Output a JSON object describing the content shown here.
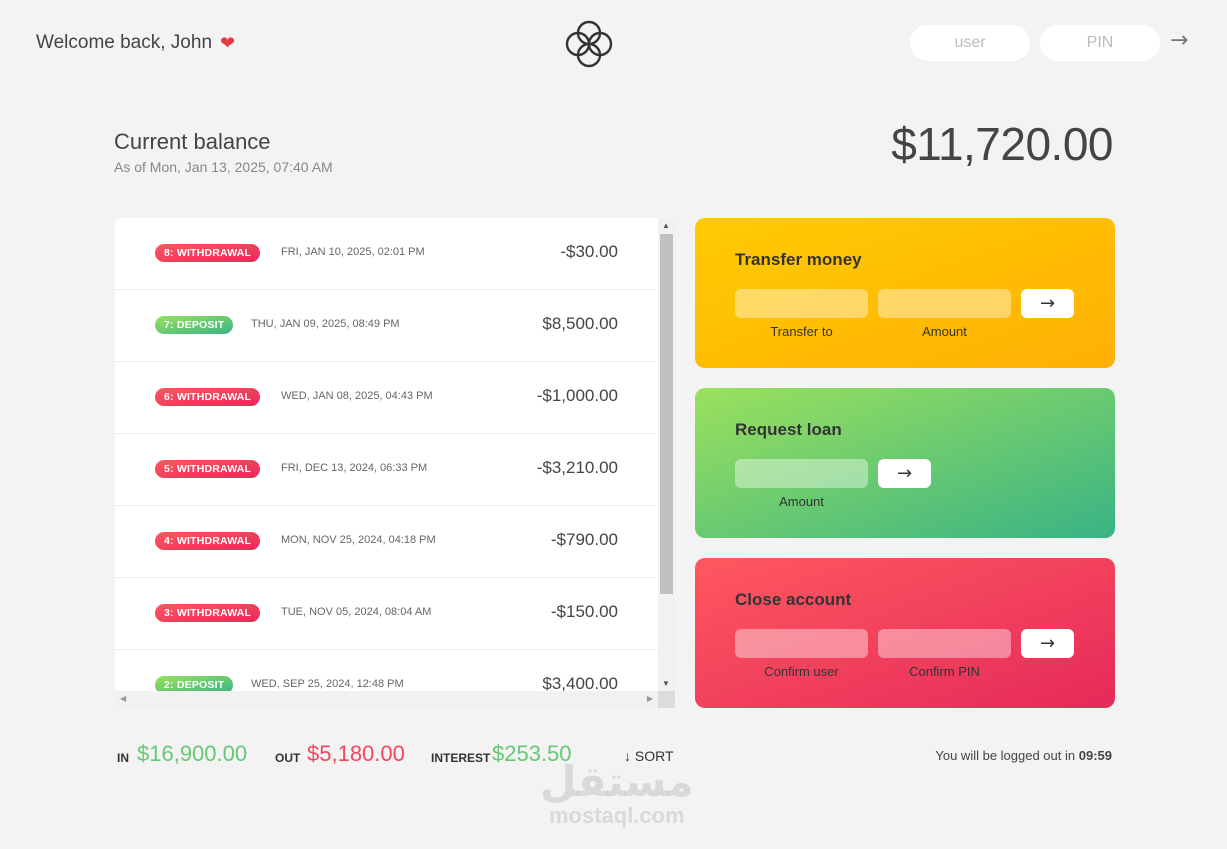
{
  "nav": {
    "welcome": "Welcome back, John",
    "heart": "❤",
    "user_placeholder": "user",
    "pin_placeholder": "PIN",
    "login_arrow": "→"
  },
  "balance": {
    "label": "Current balance",
    "date": "As of Mon, Jan 13, 2025, 07:40 AM",
    "value": "$11,720.00"
  },
  "movements": [
    {
      "type": "8: WITHDRAWAL",
      "kind": "withdrawal",
      "date": "FRI, JAN 10, 2025, 02:01 PM",
      "value": "-$30.00"
    },
    {
      "type": "7: DEPOSIT",
      "kind": "deposit",
      "date": "THU, JAN 09, 2025, 08:49 PM",
      "value": "$8,500.00"
    },
    {
      "type": "6: WITHDRAWAL",
      "kind": "withdrawal",
      "date": "WED, JAN 08, 2025, 04:43 PM",
      "value": "-$1,000.00"
    },
    {
      "type": "5: WITHDRAWAL",
      "kind": "withdrawal",
      "date": "FRI, DEC 13, 2024, 06:33 PM",
      "value": "-$3,210.00"
    },
    {
      "type": "4: WITHDRAWAL",
      "kind": "withdrawal",
      "date": "MON, NOV 25, 2024, 04:18 PM",
      "value": "-$790.00"
    },
    {
      "type": "3: WITHDRAWAL",
      "kind": "withdrawal",
      "date": "TUE, NOV 05, 2024, 08:04 AM",
      "value": "-$150.00"
    },
    {
      "type": "2: DEPOSIT",
      "kind": "deposit",
      "date": "WED, SEP 25, 2024, 12:48 PM",
      "value": "$3,400.00"
    }
  ],
  "operations": {
    "transfer": {
      "title": "Transfer money",
      "label_to": "Transfer to",
      "label_amount": "Amount",
      "button": "→"
    },
    "loan": {
      "title": "Request loan",
      "label_amount": "Amount",
      "button": "→"
    },
    "close": {
      "title": "Close account",
      "label_user": "Confirm user",
      "label_pin": "Confirm PIN",
      "button": "→"
    }
  },
  "summary": {
    "in_label": "In",
    "in_value": "$16,900.00",
    "out_label": "Out",
    "out_value": "$5,180.00",
    "interest_label": "Interest",
    "interest_value": "$253.50",
    "sort": "↓ SORT"
  },
  "logout": {
    "text": "You will be logged out in",
    "timer": "09:59"
  },
  "watermark": {
    "arabic": "مستقل",
    "latin": "mostaql.com"
  },
  "colors": {
    "deposit": "#66c873",
    "withdrawal": "#f5465d",
    "transfer": "#ffb003",
    "loan": "#39b385",
    "close": "#e52a5a"
  }
}
